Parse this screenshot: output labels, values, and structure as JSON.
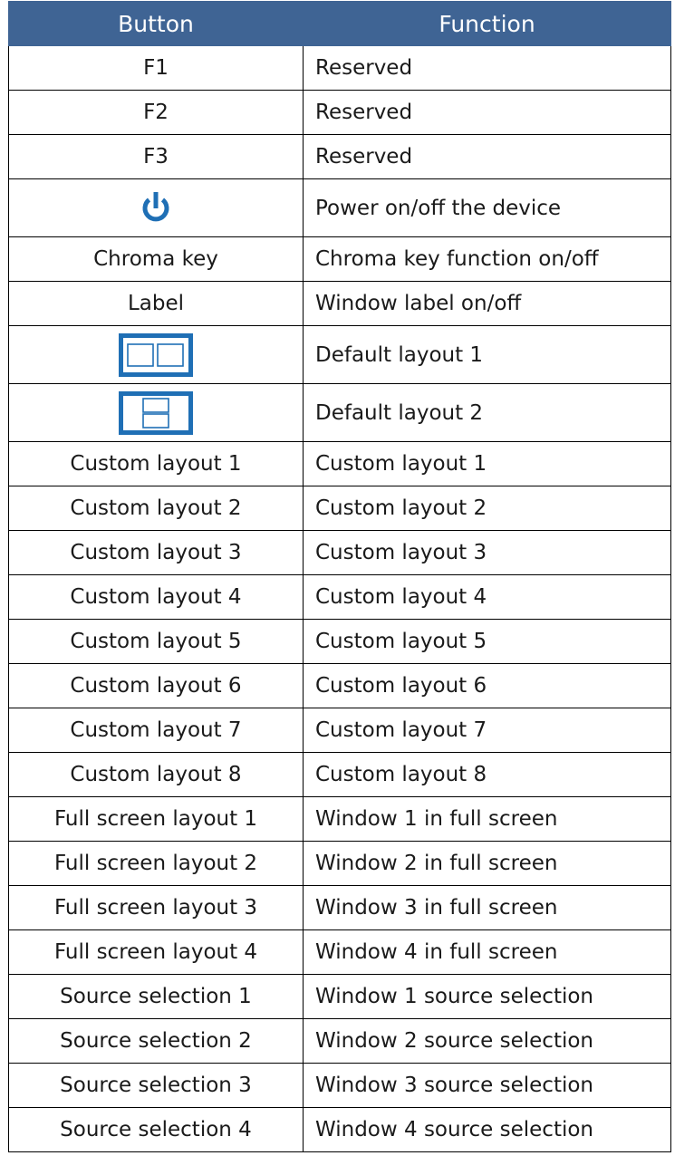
{
  "colors": {
    "header_bg": "#3f6494",
    "icon_blue": "#1f6fb5"
  },
  "table": {
    "headers": {
      "button": "Button",
      "function": "Function"
    },
    "rows": [
      {
        "button": "F1",
        "function": "Reserved"
      },
      {
        "button": "F2",
        "function": "Reserved"
      },
      {
        "button": "F3",
        "function": "Reserved"
      },
      {
        "button_icon": "power-icon",
        "function": "Power on/off the device"
      },
      {
        "button": "Chroma key",
        "function": "Chroma key function on/off"
      },
      {
        "button": "Label",
        "function": "Window label on/off"
      },
      {
        "button_icon": "side-by-side-layout-icon",
        "function": "Default layout 1"
      },
      {
        "button_icon": "stacked-layout-icon",
        "function": "Default layout 2"
      },
      {
        "button": "Custom layout 1",
        "function": "Custom layout 1"
      },
      {
        "button": "Custom layout 2",
        "function": "Custom layout 2"
      },
      {
        "button": "Custom layout 3",
        "function": "Custom layout 3"
      },
      {
        "button": "Custom layout 4",
        "function": "Custom layout 4"
      },
      {
        "button": "Custom layout 5",
        "function": "Custom layout 5"
      },
      {
        "button": "Custom layout 6",
        "function": "Custom layout 6"
      },
      {
        "button": "Custom layout 7",
        "function": "Custom layout 7"
      },
      {
        "button": "Custom layout 8",
        "function": "Custom layout 8"
      },
      {
        "button": "Full screen layout 1",
        "function": "Window 1 in full screen"
      },
      {
        "button": "Full screen layout 2",
        "function": "Window 2 in full screen"
      },
      {
        "button": "Full screen layout 3",
        "function": "Window 3 in full screen"
      },
      {
        "button": "Full screen layout 4",
        "function": "Window 4 in full screen"
      },
      {
        "button": "Source selection 1",
        "function": "Window 1 source selection"
      },
      {
        "button": "Source selection 2",
        "function": "Window 2 source selection"
      },
      {
        "button": "Source selection 3",
        "function": "Window 3 source selection"
      },
      {
        "button": "Source selection 4",
        "function": "Window 4 source selection"
      }
    ]
  }
}
